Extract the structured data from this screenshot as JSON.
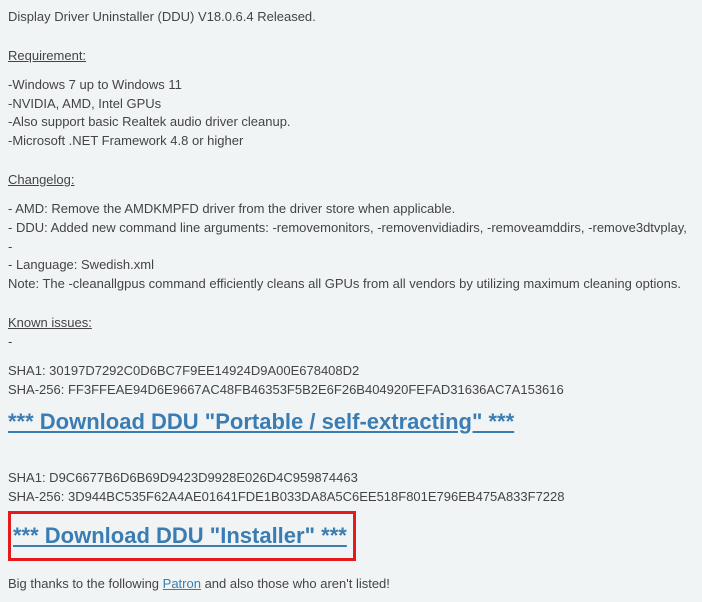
{
  "title": "Display Driver Uninstaller (DDU) V18.0.6.4 Released.",
  "requirement_heading": "Requirement:",
  "requirements": "-Windows 7 up to Windows 11\n-NVIDIA, AMD, Intel GPUs\n-Also support basic Realtek audio driver cleanup.\n-Microsoft .NET Framework 4.8 or higher",
  "changelog_heading": "Changelog:",
  "changelog": "- AMD: Remove the AMDKMPFD driver from the driver store when applicable.\n- DDU: Added new command line arguments: -removemonitors, -removenvidiadirs, -removeamddirs, -remove3dtvplay, -\n- Language: Swedish.xml\nNote: The -cleanallgpus command efficiently cleans all GPUs from all vendors by utilizing maximum cleaning options.",
  "known_issues_heading": "Known issues:",
  "known_issues": "-",
  "hash1": "SHA1: 30197D7292C0D6BC7F9EE14924D9A00E678408D2\nSHA-256: FF3FFEAE94D6E9667AC48FB46353F5B2E6F26B404920FEFAD31636AC7A153616",
  "download_portable": "*** Download DDU \"Portable / self-extracting\" ***",
  "hash2": "SHA1: D9C6677B6D6B69D9423D9928E026D4C959874463\nSHA-256: 3D944BC535F62A4AE01641FDE1B033DA8A5C6EE518F801E796EB475A833F7228",
  "download_installer": "*** Download DDU \"Installer\" ***",
  "thanks_prefix": "Big thanks to the following ",
  "patron_link": "Patron",
  "thanks_suffix": " and also those who aren't listed!",
  "colors": {
    "link": "#3b7db2",
    "highlight": "#e31b1b"
  }
}
